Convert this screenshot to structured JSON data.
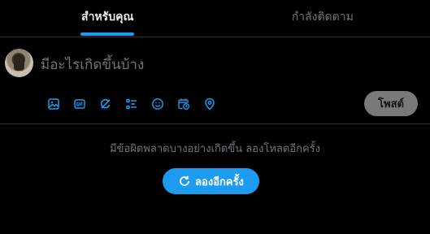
{
  "tabs": [
    {
      "label": "สำหรับคุณ",
      "active": true
    },
    {
      "label": "กำลังติดตาม",
      "active": false
    }
  ],
  "composer": {
    "placeholder": "มีอะไรเกิดขึ้นบ้าง",
    "post_label": "โพสต์",
    "tools": [
      "image-icon",
      "gif-icon",
      "grok-icon",
      "poll-icon",
      "emoji-icon",
      "schedule-icon",
      "location-icon"
    ]
  },
  "feed": {
    "error_message": "มีข้อผิดพลาดบางอย่างเกิดขึ้น ลองโหลดอีกครั้ง",
    "retry_label": "ลองอีกครั้ง"
  },
  "colors": {
    "accent": "#1d9bf0",
    "background": "#000000",
    "muted_text": "#71767b",
    "divider": "#2f3336"
  }
}
